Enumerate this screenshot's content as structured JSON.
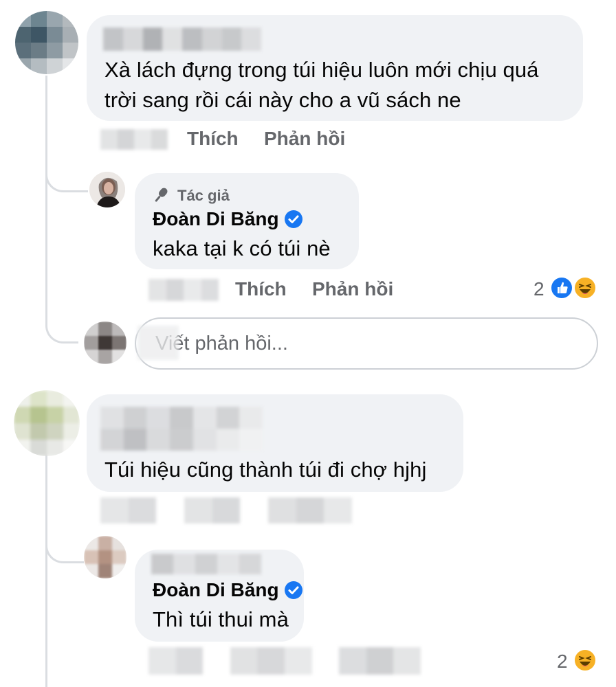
{
  "comments": [
    {
      "text_line1": "Xà lách đựng trong túi hiệu luôn mới chịu quá",
      "text_line2": "trời sang rồi cái này cho a vũ sách ne",
      "actions": {
        "like": "Thích",
        "reply": "Phản hồi"
      },
      "replies": [
        {
          "badge": "Tác giả",
          "author": "Đoàn Di Băng",
          "text": "kaka tại k có túi nè",
          "actions": {
            "like": "Thích",
            "reply": "Phản hồi"
          },
          "reaction_count": "2",
          "reactions": [
            "like-icon",
            "haha-icon"
          ]
        }
      ],
      "reply_box": {
        "placeholder": "Viết phản hồi..."
      }
    },
    {
      "text": "Túi hiệu cũng thành túi đi chợ hjhj",
      "replies": [
        {
          "author": "Đoàn Di Băng",
          "text": "Thì túi thui mà",
          "reaction_count": "2",
          "reactions": [
            "haha-icon"
          ]
        }
      ]
    }
  ],
  "colors": {
    "bubble": "#f0f2f5",
    "secondary_text": "#65676b",
    "verified": "#1877f2",
    "thread_line": "#dadde1"
  }
}
